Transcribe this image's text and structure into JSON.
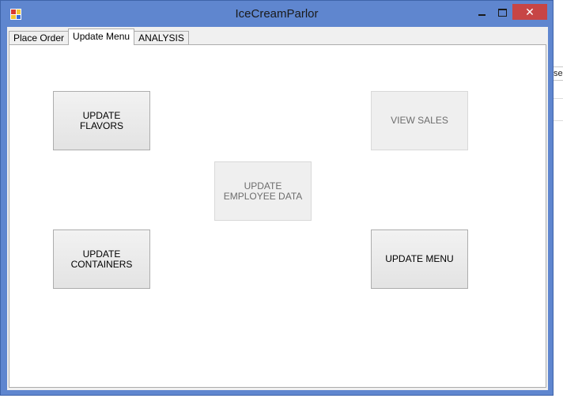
{
  "window": {
    "title": "IceCreamParlor"
  },
  "tabs": [
    {
      "label": "Place Order",
      "active": false
    },
    {
      "label": "Update Menu",
      "active": true
    },
    {
      "label": "ANALYSIS",
      "active": false
    }
  ],
  "buttons": {
    "update_flavors": {
      "label": "UPDATE FLAVORS",
      "enabled": true
    },
    "view_sales": {
      "label": "VIEW SALES",
      "enabled": false
    },
    "update_employee_data": {
      "label": "UPDATE EMPLOYEE DATA",
      "enabled": false
    },
    "update_containers": {
      "label": "UPDATE CONTAINERS",
      "enabled": true
    },
    "update_menu": {
      "label": "UPDATE MENU",
      "enabled": true
    }
  },
  "background": {
    "right_edge_text": "se"
  },
  "colors": {
    "titlebar": "#5f86cf",
    "close_button": "#c74545",
    "disabled_text": "#6d6d6d"
  },
  "icons": {
    "app": "app-icon",
    "minimize": "minimize-icon",
    "maximize": "maximize-icon",
    "close": "close-icon"
  }
}
